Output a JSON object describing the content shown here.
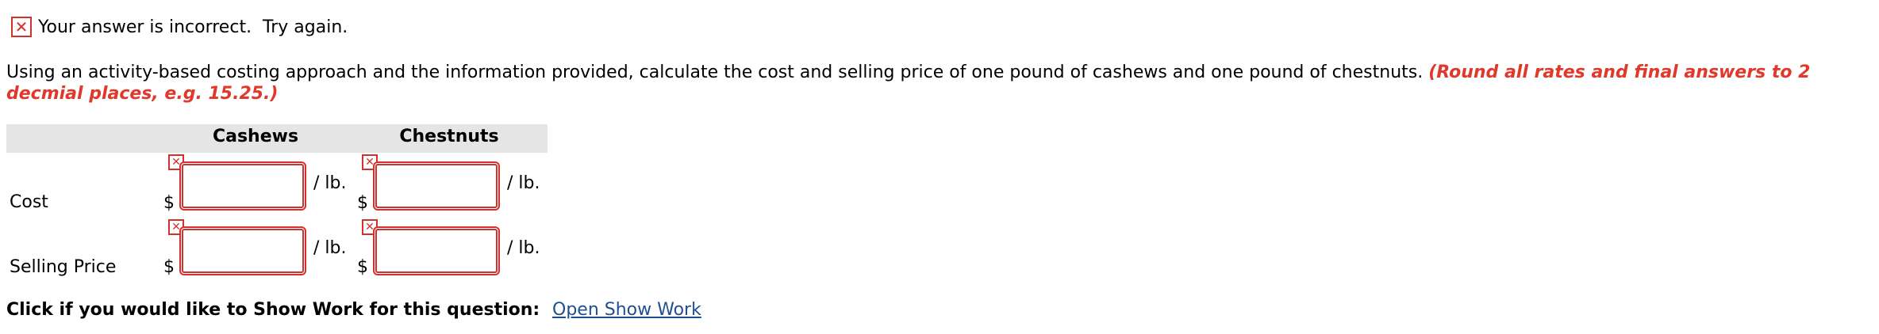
{
  "feedback": {
    "icon": "x-icon",
    "message": "Your answer is incorrect.  Try again."
  },
  "question": {
    "text": "Using an activity-based costing approach and the information provided, calculate the cost and selling price of one pound of cashews and one pound of chestnuts. ",
    "hint": "(Round all rates and final answers to 2 decmial places, e.g. 15.25.)"
  },
  "table": {
    "columns": [
      "Cashews",
      "Chestnuts"
    ],
    "rows": [
      {
        "label": "Cost",
        "currency": "$",
        "unit": "/ lb.",
        "values": [
          "",
          ""
        ]
      },
      {
        "label": "Selling Price",
        "currency": "$",
        "unit": "/ lb.",
        "values": [
          "",
          ""
        ]
      }
    ]
  },
  "show_work": {
    "prompt": "Click if you would like to Show Work for this question:",
    "link": "Open Show Work"
  },
  "colors": {
    "error": "#d2322d",
    "hint": "#e0392b",
    "link": "#1f4f8f",
    "header_bg": "#e5e5e5"
  }
}
